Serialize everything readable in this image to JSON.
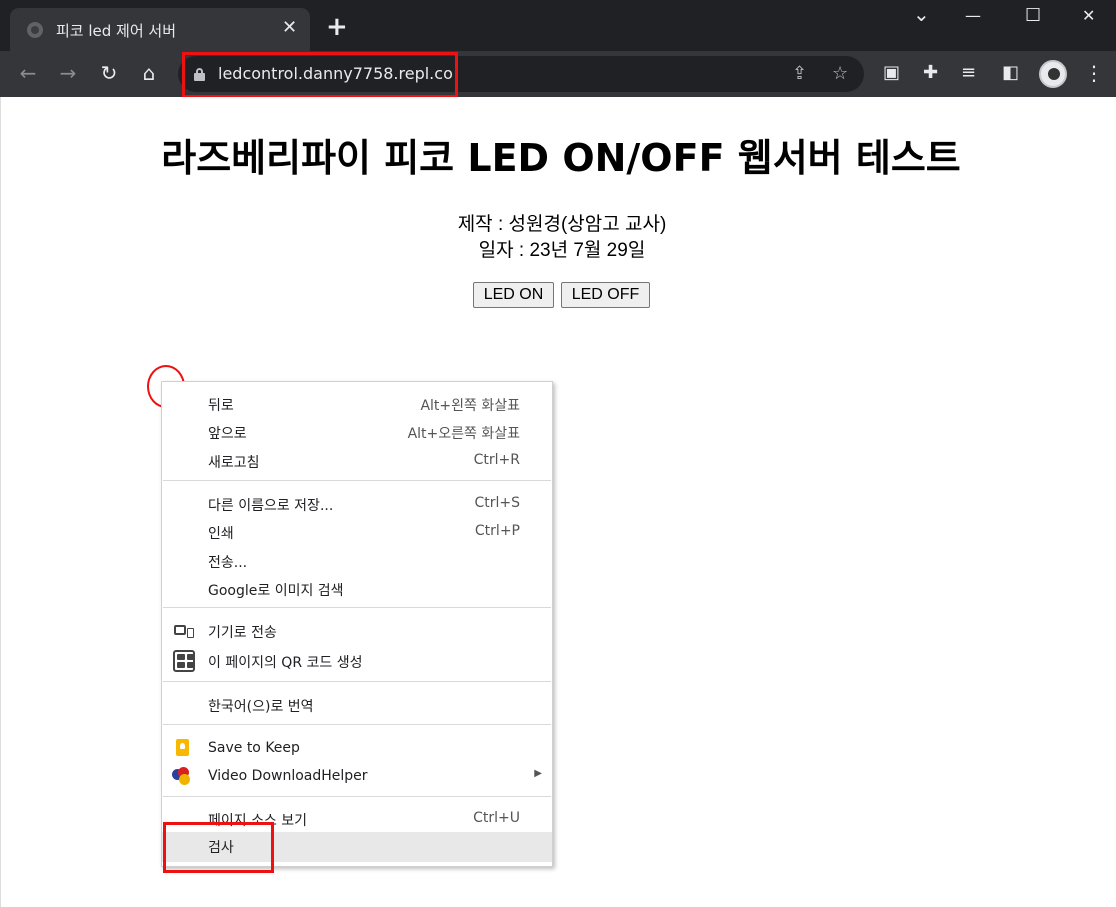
{
  "browser": {
    "tab_title": "피코 led 제어 서버",
    "tab_close": "✕",
    "new_tab": "+",
    "url": "ledcontrol.danny7758.repl.co",
    "window_controls": {
      "dropdown": "⌄",
      "minimize": "—",
      "maximize": "☐",
      "close": "✕"
    },
    "nav": {
      "back": "←",
      "forward": "→",
      "reload": "↻",
      "home": "⌂"
    },
    "icons": [
      "share-icon",
      "bookmark-star-icon",
      "picture-in-picture-icon",
      "extensions-icon",
      "media-queue-icon",
      "side-panel-icon",
      "profile-avatar",
      "menu-kebab-icon"
    ]
  },
  "page": {
    "title": "라즈베리파이 피코 LED ON/OFF 웹서버 테스트",
    "author_line": "제작 : 성원경(상암고 교사)",
    "date_line": "일자 : 23년 7월 29일",
    "led_on_label": "LED ON",
    "led_off_label": "LED OFF"
  },
  "context_menu": {
    "group1": [
      {
        "label": "뒤로",
        "shortcut": "Alt+왼쪽 화살표"
      },
      {
        "label": "앞으로",
        "shortcut": "Alt+오른쪽 화살표"
      },
      {
        "label": "새로고침",
        "shortcut": "Ctrl+R"
      }
    ],
    "group2": [
      {
        "label": "다른 이름으로 저장...",
        "shortcut": "Ctrl+S"
      },
      {
        "label": "인쇄",
        "shortcut": "Ctrl+P"
      },
      {
        "label": "전송...",
        "shortcut": ""
      },
      {
        "label": "Google로 이미지 검색",
        "shortcut": ""
      }
    ],
    "group3": [
      {
        "label": "기기로 전송",
        "icon": "device-icon"
      },
      {
        "label": "이 페이지의 QR 코드 생성",
        "icon": "qr-code-icon"
      }
    ],
    "group4": [
      {
        "label": "한국어(으)로 번역"
      }
    ],
    "group5": [
      {
        "label": "Save to Keep",
        "icon": "keep-icon"
      },
      {
        "label": "Video DownloadHelper",
        "icon": "video-downloadhelper-icon",
        "submenu": "▶"
      }
    ],
    "group6": [
      {
        "label": "페이지 소스 보기",
        "shortcut": "Ctrl+U"
      },
      {
        "label": "검사",
        "highlighted": true
      }
    ]
  },
  "colors": {
    "annotation": "#ee1111",
    "chrome_dark": "#202124",
    "chrome_toolbar": "#35363a",
    "menu_highlight": "#e8e8e8"
  }
}
